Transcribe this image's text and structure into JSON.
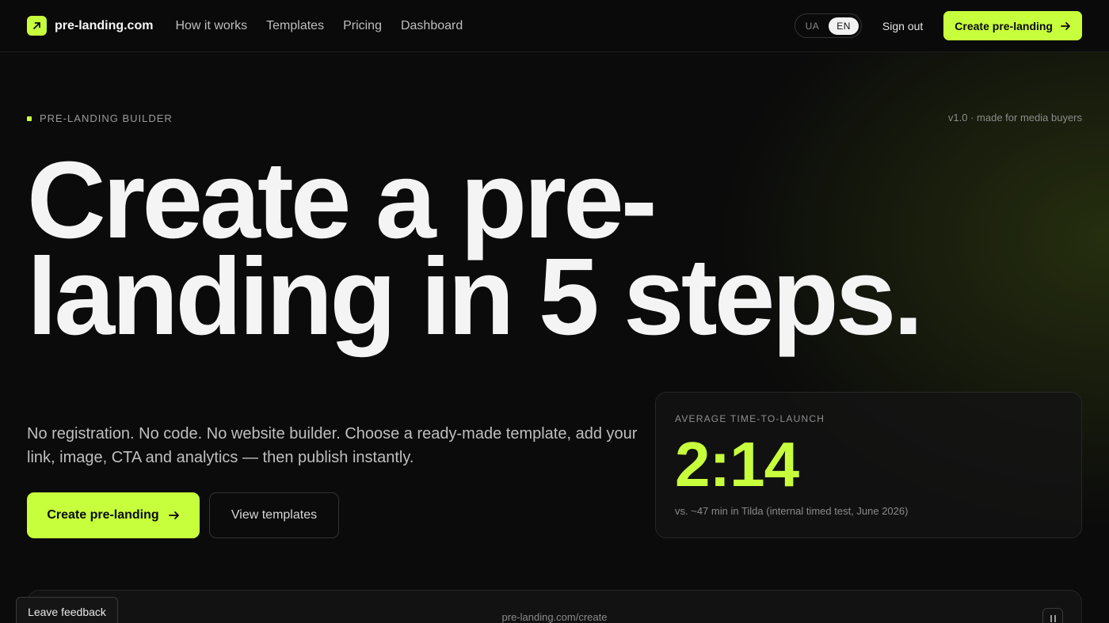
{
  "nav": {
    "brand": "pre-landing.com",
    "links": [
      "How it works",
      "Templates",
      "Pricing",
      "Dashboard"
    ],
    "lang_options": [
      "UA",
      "EN"
    ],
    "lang_active": "EN",
    "signout": "Sign out",
    "cta": "Create pre-landing"
  },
  "hero": {
    "eyebrow": "PRE-LANDING BUILDER",
    "version": "v1.0 · made for media buyers",
    "headline_line1": "Create a pre-",
    "headline_line2": "landing in 5 steps.",
    "subtext": "No registration. No code. No website builder. Choose a ready-made template, add your link, image, CTA and analytics — then publish instantly.",
    "primary_cta": "Create pre-landing",
    "secondary_cta": "View templates"
  },
  "stat": {
    "label": "AVERAGE TIME-TO-LAUNCH",
    "value": "2:14",
    "note": "vs. ~47 min in Tilda (internal timed test, June 2026)"
  },
  "preview": {
    "url": "pre-landing.com/create"
  },
  "feedback": "Leave feedback",
  "colors": {
    "accent": "#c8ff3d",
    "background": "#0b0b0b"
  }
}
